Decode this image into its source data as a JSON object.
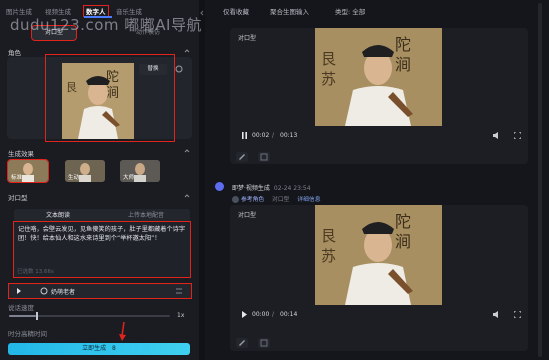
{
  "watermark": "dudu123.com 嘟嘟AI导航",
  "topnav": {
    "tabs": [
      "图片生成",
      "视频生成",
      "数字人",
      "音乐生成"
    ],
    "active_index": 2
  },
  "subtabs": [
    "对口型",
    "动作模仿"
  ],
  "role_section": {
    "label": "角色",
    "replace_label": "替换"
  },
  "effect_section": {
    "label": "生成效果",
    "options": [
      "标准",
      "生动",
      "大师"
    ],
    "selected_index": 0
  },
  "lipsync_section": {
    "label": "对口型",
    "mode_tabs": [
      "文本朗读",
      "上传本地配音"
    ],
    "active_mode": 0,
    "script_text": "记住咯，会壁云发见，见鱼傻笑的孩子，肚子里都藏着个诗字团！快！给本仙人和这水来诗里到个“举杯邀太阳”！",
    "char_count_label": "已选数 13.66s",
    "voice_name": "奶萌老者"
  },
  "speed": {
    "label": "说话速度",
    "value_label": "1x",
    "level": 0.17
  },
  "timing_label": "时分高精时间",
  "generate_button": "立即生成",
  "generate_cost": "8",
  "right_tabs": [
    "仅看收藏",
    "聚合生图输入",
    "类型: 全部"
  ],
  "messages": [
    {
      "label": "对口型",
      "time_current": "00:02",
      "time_total": "00:13"
    },
    {
      "label": "对口型",
      "time_current": "00:00",
      "time_total": "00:14"
    }
  ],
  "author": {
    "name": "即梦·视频生成",
    "timestamp": "02-24 23:54",
    "role_link": "参考角色",
    "version": "对口型",
    "detail": "详细信息"
  },
  "colors": {
    "accent": "#4c7bff",
    "generate": "#22b7e8",
    "highlight_box": "#e0241c"
  }
}
